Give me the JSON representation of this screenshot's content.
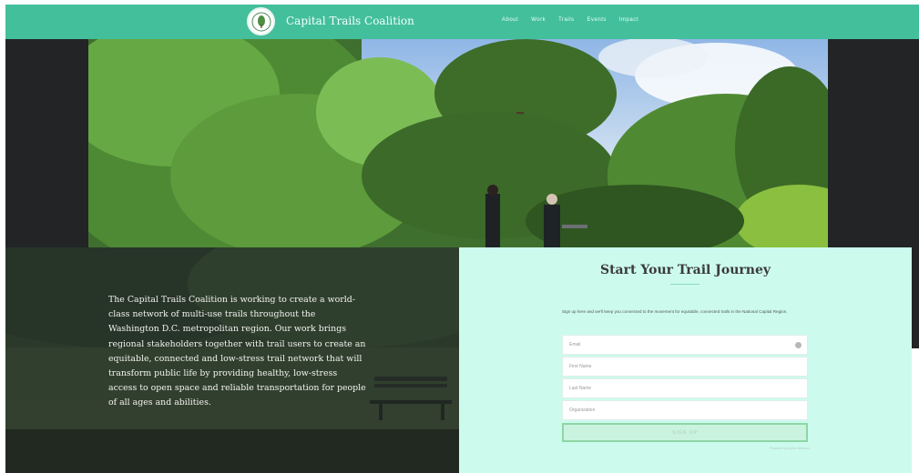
{
  "header": {
    "brand": "Capital Trails Coalition",
    "nav": [
      "About",
      "Work",
      "Trails",
      "Events",
      "Impact"
    ]
  },
  "hero": {
    "mission": "The Capital Trails Coalition is working to create a world-class network of multi-use trails throughout the Washington D.C. metropolitan region. Our work brings regional stakeholders together with trail users to create an equitable, connected and low-stress trail network that will transform public life by providing healthy, low-stress access to open space and reliable transportation for people of all ages and abilities."
  },
  "form": {
    "title": "Start Your Trail Journey",
    "intro": "Sign up here and we'll keep you connected to the movement for equitable, connected trails in the National Capital Region.",
    "fields": [
      {
        "placeholder": "Email"
      },
      {
        "placeholder": "First Name"
      },
      {
        "placeholder": "Last Name"
      },
      {
        "placeholder": "Organization"
      }
    ],
    "submit": "SIGN UP",
    "powered": "Powered by Action Network"
  },
  "colors": {
    "header_bg": "#43bf9c",
    "form_bg": "#ccfbee",
    "button_border": "#8ed6a5",
    "dark_band": "#222426"
  },
  "icons": {
    "logo": "tree-leaf-logo-icon",
    "email_field": "contact-card-icon"
  }
}
